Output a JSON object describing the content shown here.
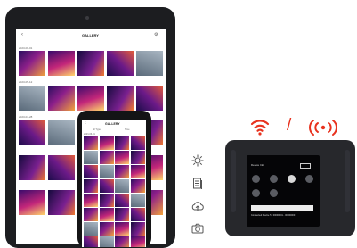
{
  "tablet": {
    "header_title": "GALLERY",
    "tabs": [
      "All Types",
      "Time"
    ],
    "section1": "2023-06-01",
    "section2": "2023-05-12",
    "section3": "2023-04-28"
  },
  "phone": {
    "header_title": "GALLERY",
    "tabs": [
      "All Types",
      "Time"
    ],
    "section1": "2023-06-01",
    "section2": "2023-05-12"
  },
  "feature_icons": [
    "settings-icon",
    "document-icon",
    "cloud-upload-icon",
    "camera-icon"
  ],
  "connectivity": {
    "separator": "/",
    "wifi_color": "#e8321e",
    "radio_color": "#e8321e"
  },
  "device": {
    "title": "Device Info",
    "footer_text": "Connected Device 5 - 00000001 - 00000000"
  }
}
